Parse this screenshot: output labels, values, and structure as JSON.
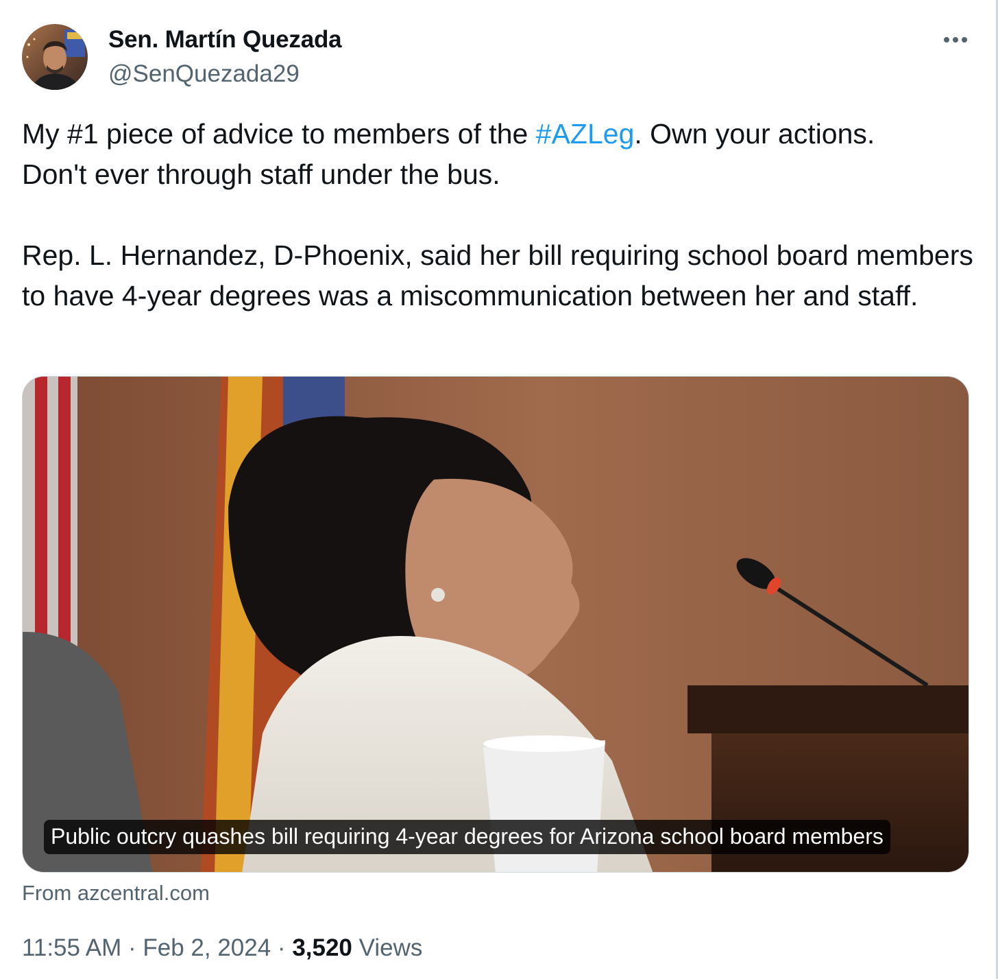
{
  "author": {
    "display_name": "Sen. Martín Quezada",
    "handle": "@SenQuezada29",
    "avatar_icon": "profile-photo"
  },
  "tweet": {
    "text_part1": "My #1 piece of advice to members of the ",
    "hashtag": "#AZLeg",
    "text_part2": ". Own your actions.\nDon't ever through staff under the bus.\n\nRep. L. Hernandez, D-Phoenix, said her bill requiring school board members to have 4-year degrees was a miscommunication between her and staff."
  },
  "card": {
    "headline": "Public outcry quashes bill requiring 4-year degrees for Arizona school board members",
    "source": "From azcentral.com",
    "image_icon": "article-photo"
  },
  "meta": {
    "time": "11:55 AM",
    "separator": " · ",
    "date": "Feb 2, 2024",
    "views_count": "3,520",
    "views_label": "Views"
  },
  "menu": {
    "more_icon": "more-horizontal-icon"
  },
  "colors": {
    "text": "#0f1419",
    "secondary": "#536471",
    "link": "#1d9bf0",
    "border": "#cfd9de"
  }
}
